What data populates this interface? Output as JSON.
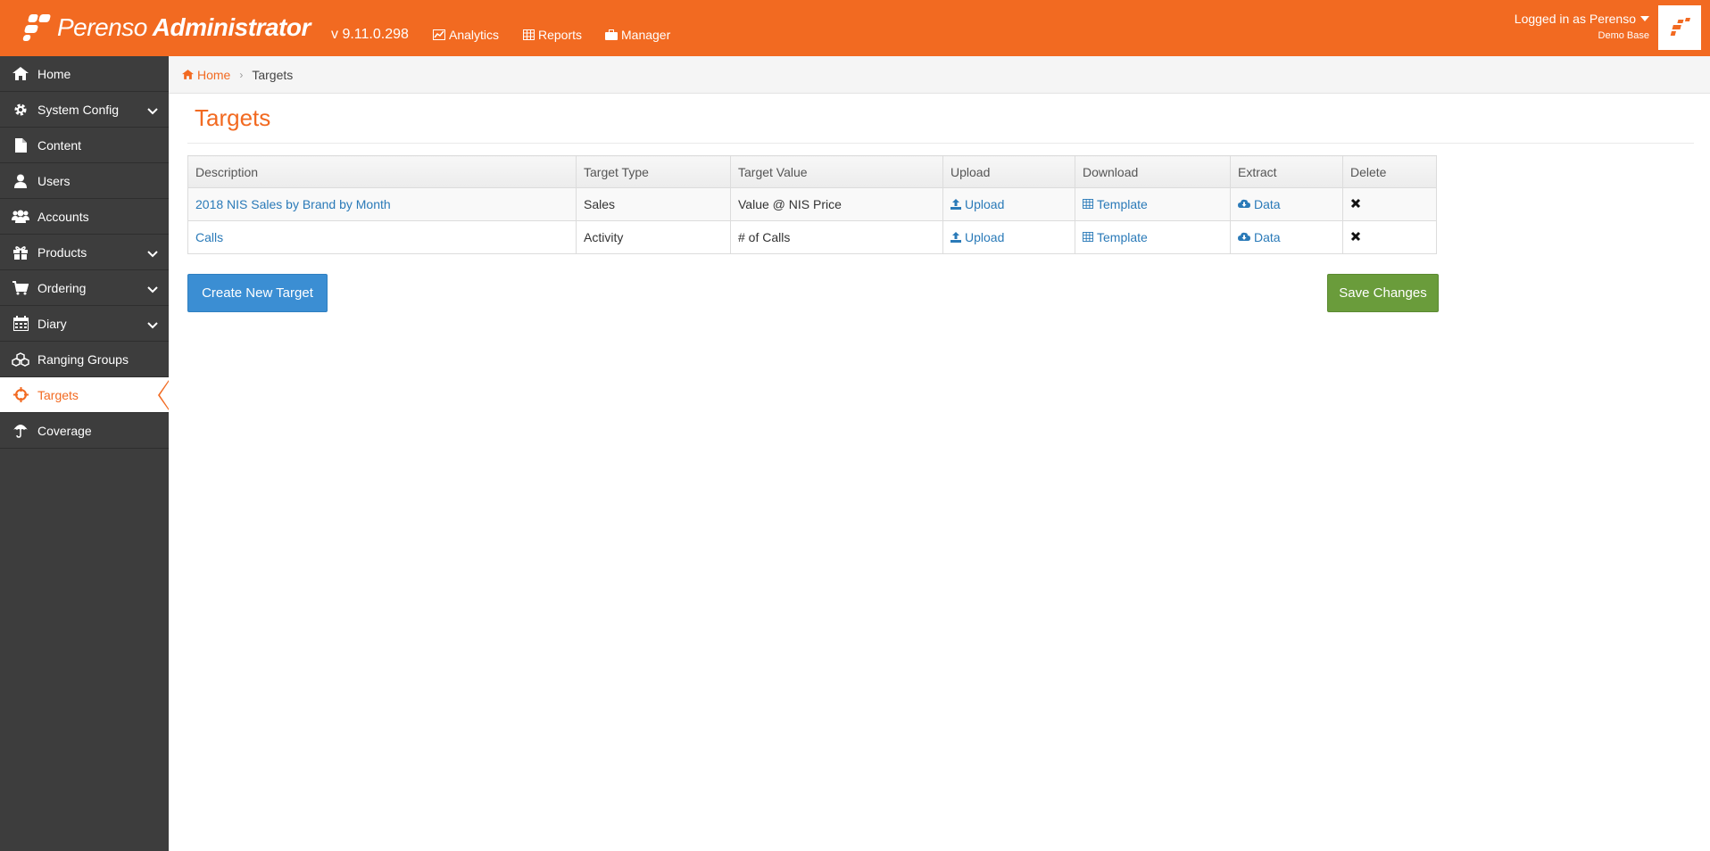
{
  "app": {
    "brand_light": "Perenso",
    "brand_bold": "Administrator",
    "version": "v 9.11.0.298"
  },
  "topnav": {
    "analytics": "Analytics",
    "reports": "Reports",
    "manager": "Manager"
  },
  "user": {
    "logged_in": "Logged in as Perenso",
    "database": "Demo Base"
  },
  "sidebar": {
    "items": [
      {
        "label": "Home",
        "icon": "home-icon",
        "has_children": false
      },
      {
        "label": "System Config",
        "icon": "gear-icon",
        "has_children": true
      },
      {
        "label": "Content",
        "icon": "file-icon",
        "has_children": false
      },
      {
        "label": "Users",
        "icon": "user-icon",
        "has_children": false
      },
      {
        "label": "Accounts",
        "icon": "users-icon",
        "has_children": false
      },
      {
        "label": "Products",
        "icon": "gift-icon",
        "has_children": true
      },
      {
        "label": "Ordering",
        "icon": "cart-icon",
        "has_children": true
      },
      {
        "label": "Diary",
        "icon": "calendar-icon",
        "has_children": true
      },
      {
        "label": "Ranging Groups",
        "icon": "cubes-icon",
        "has_children": false
      },
      {
        "label": "Targets",
        "icon": "crosshairs-icon",
        "has_children": false,
        "active": true
      },
      {
        "label": "Coverage",
        "icon": "umbrella-icon",
        "has_children": false
      }
    ]
  },
  "breadcrumb": {
    "home": "Home",
    "current": "Targets"
  },
  "page": {
    "title": "Targets"
  },
  "table": {
    "columns": [
      "Description",
      "Target Type",
      "Target Value",
      "Upload",
      "Download",
      "Extract",
      "Delete"
    ],
    "rows": [
      {
        "description": "2018 NIS Sales by Brand by Month",
        "type": "Sales",
        "value": "Value @ NIS Price",
        "upload": "Upload",
        "download": "Template",
        "extract": "Data"
      },
      {
        "description": "Calls",
        "type": "Activity",
        "value": "# of Calls",
        "upload": "Upload",
        "download": "Template",
        "extract": "Data"
      }
    ]
  },
  "buttons": {
    "create": "Create New Target",
    "save": "Save Changes"
  },
  "colors": {
    "brand_orange": "#f26a21",
    "sidebar_bg": "#3d3d3d",
    "link_blue": "#2a7ab8",
    "create_blue": "#3b8ed3",
    "save_green": "#6a9c3b"
  }
}
